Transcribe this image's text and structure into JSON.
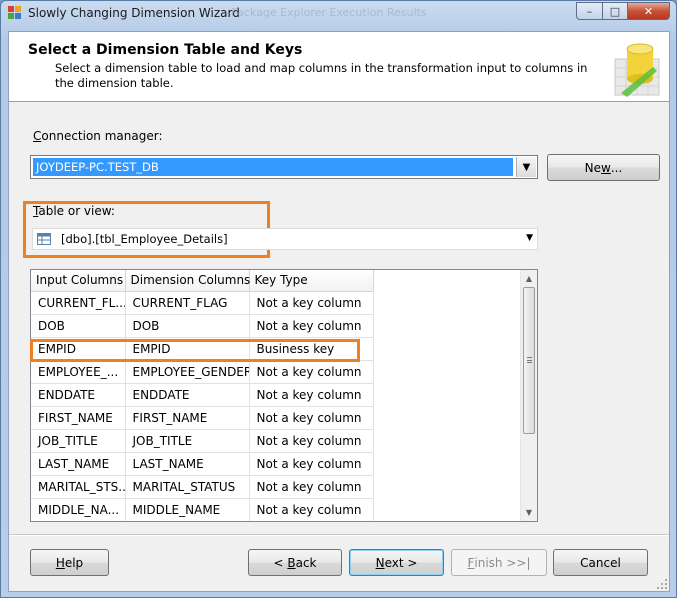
{
  "window": {
    "title": "Slowly Changing Dimension Wizard",
    "background_tabs_text": "Package Explorer      Execution Results",
    "controls": {
      "minimize": "–",
      "maximize": "□",
      "close": "✕"
    }
  },
  "header": {
    "title": "Select a Dimension Table and Keys",
    "description": "Select a dimension table to load and map columns in the transformation input to columns in the dimension table."
  },
  "connection": {
    "label_accel": "C",
    "label_rest": "onnection manager:",
    "selected": "JOYDEEP-PC.TEST_DB",
    "new_button_pre": "Ne",
    "new_button_accel": "w",
    "new_button_post": "..."
  },
  "table": {
    "label_accel": "T",
    "label_rest": "able or view:",
    "selected": "[dbo].[tbl_Employee_Details]"
  },
  "grid": {
    "headers": [
      "Input Columns",
      "Dimension Columns",
      "Key Type"
    ],
    "rows": [
      [
        "CURRENT_FL...",
        "CURRENT_FLAG",
        "Not a key column"
      ],
      [
        "DOB",
        "DOB",
        "Not a key column"
      ],
      [
        "EMPID",
        "EMPID",
        "Business key"
      ],
      [
        "EMPLOYEE_...",
        "EMPLOYEE_GENDER",
        "Not a key column"
      ],
      [
        "ENDDATE",
        "ENDDATE",
        "Not a key column"
      ],
      [
        "FIRST_NAME",
        "FIRST_NAME",
        "Not a key column"
      ],
      [
        "JOB_TITLE",
        "JOB_TITLE",
        "Not a key column"
      ],
      [
        "LAST_NAME",
        "LAST_NAME",
        "Not a key column"
      ],
      [
        "MARITAL_STS...",
        "MARITAL_STATUS",
        "Not a key column"
      ],
      [
        "MIDDLE_NA...",
        "MIDDLE_NAME",
        "Not a key column"
      ]
    ]
  },
  "buttons": {
    "help_accel": "H",
    "help_rest": "elp",
    "back_pre": "< ",
    "back_accel": "B",
    "back_rest": "ack",
    "next_accel": "N",
    "next_rest": "ext >",
    "finish_accel": "F",
    "finish_rest": "inish >>|",
    "cancel": "Cancel"
  },
  "colors": {
    "highlight": "#f07f22",
    "selection": "#3399ff"
  }
}
